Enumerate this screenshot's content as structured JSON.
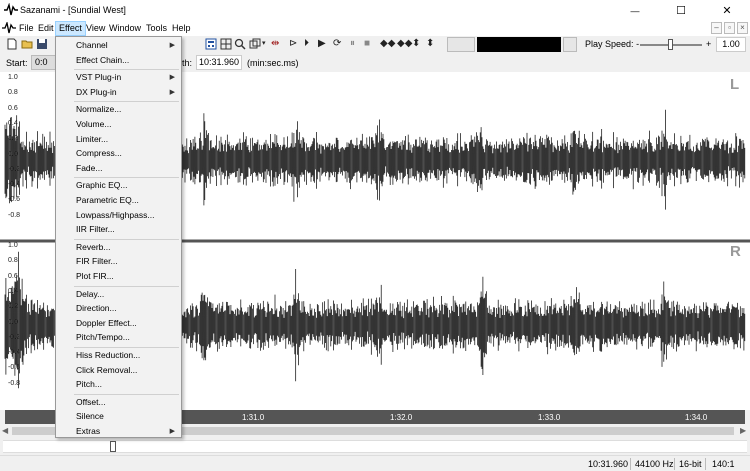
{
  "window": {
    "title": "Sazanami - [Sundial West]",
    "controls": {
      "minimize": "—",
      "maximize": "☐",
      "close": "✕"
    }
  },
  "menubar": {
    "items": [
      {
        "label": "File"
      },
      {
        "label": "Edit"
      },
      {
        "label": "Effect"
      },
      {
        "label": "View"
      },
      {
        "label": "Window"
      },
      {
        "label": "Tools"
      },
      {
        "label": "Help"
      }
    ],
    "mdi": {
      "minimize": "–",
      "restore": "▫",
      "close": "×"
    }
  },
  "toolbar": {
    "play_speed_label": "Play Speed:",
    "minus": "-",
    "plus": "+",
    "play_speed_value": "1.00",
    "colors": {
      "swatch_light": "#e6e6e6",
      "swatch_dark": "#000000"
    }
  },
  "selection": {
    "start_label": "Start:",
    "start_value": "0:0",
    "length_label": "th:",
    "length_value": "10:31.960",
    "unit": "(min:sec.ms)"
  },
  "waveform": {
    "left_channel_label": "L",
    "right_channel_label": "R",
    "amplitude_labels_top": [
      "1.0",
      "0.8",
      "0.6",
      "0.4",
      "0.2",
      "0.0",
      "-0.2",
      "-0.4",
      "-0.6",
      "-0.8"
    ],
    "amplitude_labels_bottom": [
      "1.0",
      "0.8",
      "0.6",
      "0.4",
      "0.2",
      "0.0",
      "-0.2",
      "-0.4",
      "-0.6",
      "-0.8"
    ],
    "ruler_labels": [
      "1:31.0",
      "1:32.0",
      "1:33.0",
      "1:34.0"
    ]
  },
  "status": {
    "length": "10:31.960",
    "sample_rate": "44100 Hz",
    "bit_depth": "16-bit",
    "zoom": "140:1"
  },
  "effect_menu": {
    "groups": [
      [
        {
          "label": "Channel",
          "submenu": true
        },
        {
          "label": "Effect Chain..."
        }
      ],
      [
        {
          "label": "VST Plug-in",
          "submenu": true
        },
        {
          "label": "DX Plug-in",
          "submenu": true
        }
      ],
      [
        {
          "label": "Normalize..."
        },
        {
          "label": "Volume..."
        },
        {
          "label": "Limiter..."
        },
        {
          "label": "Compress..."
        },
        {
          "label": "Fade..."
        }
      ],
      [
        {
          "label": "Graphic EQ..."
        },
        {
          "label": "Parametric EQ..."
        },
        {
          "label": "Lowpass/Highpass..."
        },
        {
          "label": "IIR Filter..."
        }
      ],
      [
        {
          "label": "Reverb..."
        },
        {
          "label": "FIR Filter..."
        },
        {
          "label": "Plot FIR..."
        }
      ],
      [
        {
          "label": "Delay..."
        },
        {
          "label": "Direction..."
        },
        {
          "label": "Doppler Effect..."
        },
        {
          "label": "Pitch/Tempo..."
        }
      ],
      [
        {
          "label": "Hiss Reduction..."
        },
        {
          "label": "Click Removal..."
        },
        {
          "label": "Pitch..."
        }
      ],
      [
        {
          "label": "Offset..."
        },
        {
          "label": "Silence"
        },
        {
          "label": "Extras",
          "submenu": true
        }
      ]
    ]
  }
}
